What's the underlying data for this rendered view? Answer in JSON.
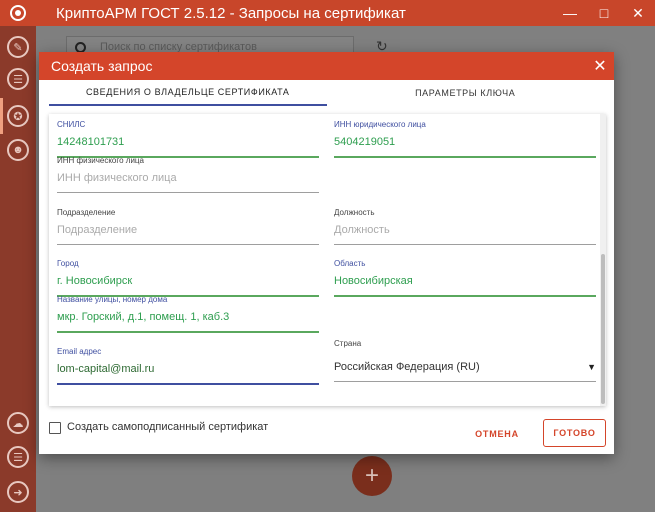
{
  "window": {
    "title": "КриптоАРМ ГОСТ 2.5.12 - Запросы на сертификат",
    "minimize_icon": "minimize-icon",
    "maximize_icon": "maximize-icon",
    "close_icon": "close-icon"
  },
  "background": {
    "search_placeholder": "Поиск по списку сертификатов",
    "fab_label": "+"
  },
  "dialog": {
    "title": "Создать запрос",
    "close_label": "✕",
    "tabs": [
      {
        "label": "СВЕДЕНИЯ О ВЛАДЕЛЬЦЕ СЕРТИФИКАТА",
        "active": true
      },
      {
        "label": "ПАРАМЕТРЫ КЛЮЧА",
        "active": false
      }
    ],
    "fields": {
      "snils": {
        "label": "СНИЛС",
        "value": "14248101731"
      },
      "inn_legal": {
        "label": "ИНН юридического лица",
        "value": "5404219051"
      },
      "inn_person": {
        "label": "ИНН физического лица",
        "placeholder": "ИНН физического лица"
      },
      "department": {
        "label": "Подразделение",
        "placeholder": "Подразделение"
      },
      "position": {
        "label": "Должность",
        "placeholder": "Должность"
      },
      "city": {
        "label": "Город",
        "value": "г. Новосибирск"
      },
      "region": {
        "label": "Область",
        "value": "Новосибирская"
      },
      "street": {
        "label": "Название улицы, номер дома",
        "value": "мкр. Горский, д.1, помещ. 1, каб.3"
      },
      "email": {
        "label": "Email адрес",
        "value": "lom-capital@mail.ru"
      },
      "country": {
        "label": "Страна",
        "value": "Российская Федерация (RU)"
      }
    },
    "self_signed_label": "Создать самоподписанный сертификат",
    "cancel_label": "ОТМЕНА",
    "done_label": "ГОТОВО"
  },
  "colors": {
    "accent": "#d4452a",
    "tab_indicator": "#3f4fa0",
    "valid_green": "#5aa85e"
  }
}
